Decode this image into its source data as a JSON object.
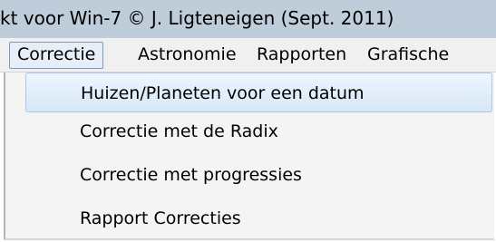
{
  "window": {
    "title": "kt voor Win-7 © J. Ligteneigen (Sept. 2011)"
  },
  "menu_bar": {
    "items": [
      {
        "label": "Correctie",
        "active": true
      },
      {
        "label": "Astronomie"
      },
      {
        "label": "Rapporten"
      },
      {
        "label": "Grafische"
      }
    ]
  },
  "dropdown": {
    "items": [
      {
        "label": "Huizen/Planeten voor een datum",
        "highlighted": true
      },
      {
        "label": "Correctie met de Radix"
      },
      {
        "label": "Correctie met progressies"
      },
      {
        "label": "Rapport Correcties"
      }
    ]
  }
}
